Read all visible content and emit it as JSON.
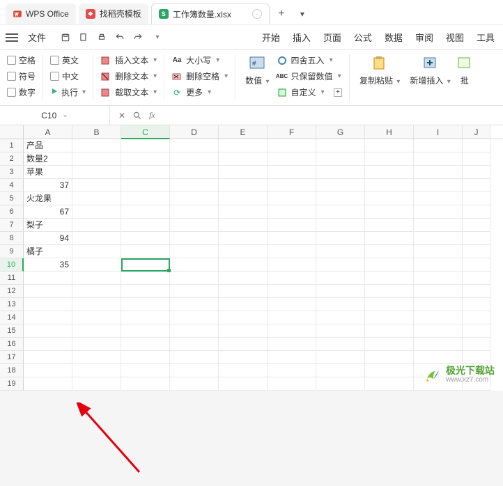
{
  "tabs": {
    "ws": "WPS Office",
    "d": "找稻壳模板",
    "s": "工作簿数量.xlsx"
  },
  "file_label": "文件",
  "menu": {
    "start": "开始",
    "insert": "插入",
    "page": "页面",
    "formula": "公式",
    "data": "数据",
    "review": "审阅",
    "view": "视图",
    "tool": "工具"
  },
  "ribbon": {
    "c_space": "空格",
    "c_symbol": "符号",
    "c_number": "数字",
    "c_english": "英文",
    "c_chinese": "中文",
    "c_exec": "执行",
    "insert_text": "插入文本",
    "delete_text": "删除文本",
    "extract_text": "截取文本",
    "cases": "大小写",
    "delspace": "删除空格",
    "more": "更多",
    "value": "数值",
    "round": "四舍五入",
    "keepnum": "只保留数值",
    "custom": "自定义",
    "copypaste": "复制粘贴",
    "newinsert": "新增插入",
    "batch": "批"
  },
  "namebox": "C10",
  "chart_data": {
    "type": "table",
    "title": "",
    "columns": [
      "A",
      "B",
      "C",
      "D",
      "E",
      "F",
      "G",
      "H",
      "I",
      "J"
    ],
    "rows": [
      {
        "r": 1,
        "A": "产品"
      },
      {
        "r": 2,
        "A": "数量2"
      },
      {
        "r": 3,
        "A": "苹果"
      },
      {
        "r": 4,
        "A": 37
      },
      {
        "r": 5,
        "A": "火龙果"
      },
      {
        "r": 6,
        "A": 67
      },
      {
        "r": 7,
        "A": "梨子"
      },
      {
        "r": 8,
        "A": 94
      },
      {
        "r": 9,
        "A": "橘子"
      },
      {
        "r": 10,
        "A": 35
      }
    ],
    "active_cell": "C10"
  },
  "sheet": {
    "cols": [
      "A",
      "B",
      "C",
      "D",
      "E",
      "F",
      "G",
      "H",
      "I",
      "J"
    ],
    "cells": {
      "1": "产品",
      "2": "数量2",
      "3": "苹果",
      "4": "37",
      "5": "火龙果",
      "6": "67",
      "7": "梨子",
      "8": "94",
      "9": "橘子",
      "10": "35"
    }
  },
  "watermark": {
    "name": "极光下载站",
    "url": "www.xz7.com"
  }
}
